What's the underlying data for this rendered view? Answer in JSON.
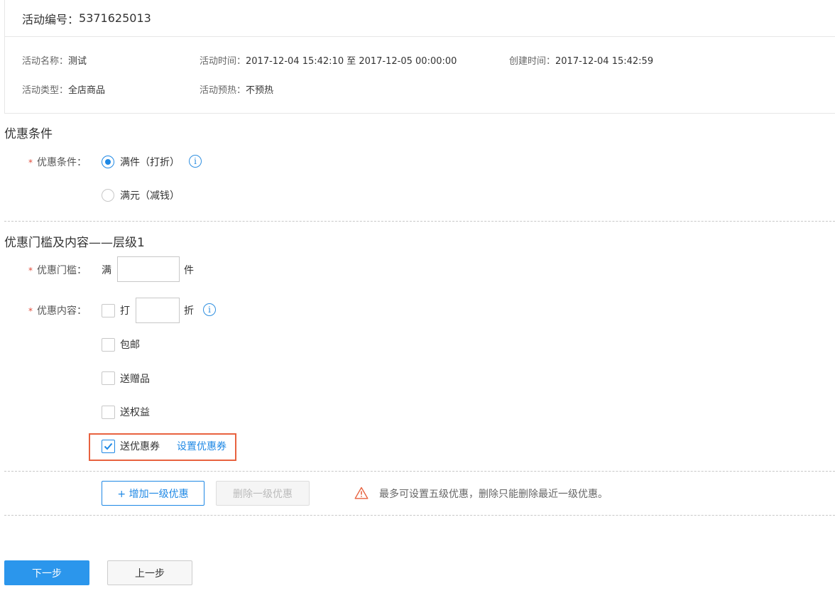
{
  "header": {
    "activity_id_label": "活动编号：",
    "activity_id": "5371625013"
  },
  "info": {
    "name_label": "活动名称：",
    "name_value": "测试",
    "time_label": "活动时间：",
    "time_value": "2017-12-04 15:42:10 至 2017-12-05 00:00:00",
    "created_label": "创建时间：",
    "created_value": "2017-12-04 15:42:59",
    "type_label": "活动类型：",
    "type_value": "全店商品",
    "preheat_label": "活动预热：",
    "preheat_value": "不预热"
  },
  "conditions": {
    "section_title": "优惠条件",
    "field_label": "优惠条件：",
    "options": [
      {
        "label": "满件（打折）",
        "selected": true
      },
      {
        "label": "满元（减钱）",
        "selected": false
      }
    ],
    "info_icon": "i"
  },
  "tier": {
    "section_title": "优惠门槛及内容——层级1",
    "threshold_label": "优惠门槛：",
    "threshold_prefix": "满",
    "threshold_suffix": "件",
    "threshold_value": "",
    "content_label": "优惠内容：",
    "discount_prefix": "打",
    "discount_suffix": "折",
    "discount_value": "",
    "info_icon": "i",
    "options": [
      {
        "label": "包邮",
        "checked": false
      },
      {
        "label": "送赠品",
        "checked": false
      },
      {
        "label": "送权益",
        "checked": false
      },
      {
        "label": "送优惠券",
        "checked": true
      }
    ],
    "coupon_link": "设置优惠券"
  },
  "tier_actions": {
    "add_label": "+ 增加一级优惠",
    "delete_label": "删除一级优惠",
    "warning": "最多可设置五级优惠，删除只能删除最近一级优惠。"
  },
  "footer": {
    "next_label": "下一步",
    "prev_label": "上一步"
  },
  "colors": {
    "accent": "#1e88e5",
    "required": "#e04b3a",
    "highlight": "#e8623f",
    "warning": "#e8623f"
  }
}
